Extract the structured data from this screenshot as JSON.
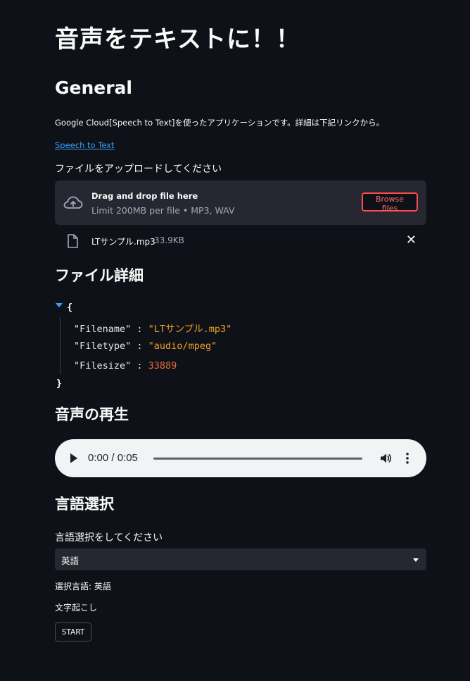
{
  "page": {
    "title": "音声をテキストに！！"
  },
  "general": {
    "heading": "General",
    "description": "Google Cloud[Speech to Text]を使ったアプリケーションです。詳細は下記リンクから。",
    "link_text": "Speech to Text"
  },
  "uploader": {
    "label": "ファイルをアップロードしてください",
    "drop_title": "Drag and drop file here",
    "limit_text": "Limit 200MB per file • MP3, WAV",
    "browse_label": "Browse files",
    "file_name": "LTサンプル.mp3",
    "file_size": "33.9KB",
    "close_symbol": "✕"
  },
  "file_details": {
    "heading": "ファイル詳細",
    "brace_open": "{",
    "brace_close": "}",
    "entries": [
      {
        "key": "\"Filename\"",
        "sep": " : ",
        "value": "\"LTサンプル.mp3\""
      },
      {
        "key": "\"Filetype\"",
        "sep": " : ",
        "value": "\"audio/mpeg\""
      },
      {
        "key": "\"Filesize\"",
        "sep": " : ",
        "value": "33889"
      }
    ]
  },
  "audio": {
    "heading": "音声の再生",
    "time": "0:00 / 0:05",
    "progress": 0
  },
  "language": {
    "heading": "言語選択",
    "label": "言語選択をしてください",
    "selected": "英語",
    "selected_text": "選択言語: 英語"
  },
  "transcribe": {
    "label": "文字起こし",
    "start_label": "START"
  },
  "colors": {
    "background": "#0e1117",
    "panel": "#262730",
    "accent": "#ff4b4b",
    "link": "#3b9cff",
    "json_string": "#f0a028",
    "json_number": "#e86b3a"
  },
  "icons": {
    "upload": "cloud-upload-icon",
    "file": "file-icon",
    "close": "close-icon",
    "caret": "caret-down-icon",
    "play": "play-icon",
    "volume": "volume-icon",
    "more": "more-vert-icon",
    "dropdown": "chevron-down-icon"
  }
}
